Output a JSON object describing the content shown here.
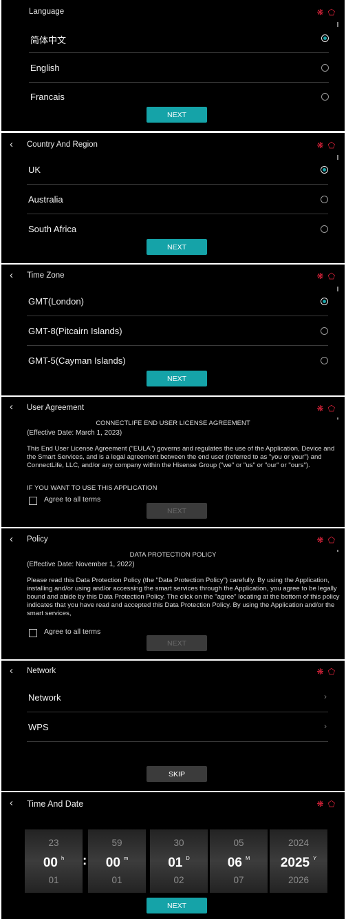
{
  "language": {
    "title": "Language",
    "options": [
      {
        "label": "简体中文",
        "selected": true
      },
      {
        "label": "English",
        "selected": false
      },
      {
        "label": "Francais",
        "selected": false
      }
    ],
    "next_label": "NEXT"
  },
  "country": {
    "title": "Country And Region",
    "options": [
      {
        "label": "UK",
        "selected": true
      },
      {
        "label": "Australia",
        "selected": false
      },
      {
        "label": "South Africa",
        "selected": false
      }
    ],
    "next_label": "NEXT"
  },
  "timezone": {
    "title": "Time Zone",
    "options": [
      {
        "label": "GMT(London)",
        "selected": true
      },
      {
        "label": "GMT-8(Pitcairn Islands)",
        "selected": false
      },
      {
        "label": "GMT-5(Cayman Islands)",
        "selected": false
      }
    ],
    "next_label": "NEXT"
  },
  "user_agreement": {
    "title": "User Agreement",
    "doc_title": "CONNECTLIFE END USER LICENSE AGREEMENT",
    "effective_date": "(Effective Date: March 1, 2023)",
    "body": "This End User License Agreement (\"EULA\") governs and regulates the use of the Application, Device and the Smart Services, and is a legal agreement between the end user (referred to as \"you or your\") and ConnectLife, LLC, and/or any company within the Hisense Group (\"we\" or \"us\" or \"our\" or \"ours\").",
    "body2": "IF YOU WANT TO USE THIS APPLICATION",
    "agree_label": "Agree to all terms",
    "next_label": "NEXT"
  },
  "policy": {
    "title": "Policy",
    "doc_title": "DATA PROTECTION POLICY",
    "effective_date": "(Effective Date: November 1, 2022)",
    "body": "Please read this Data Protection Policy (the \"Data Protection Policy\") carefully. By using the Application, installing and/or using and/or accessing the smart services through the Application, you agree to be legally bound and abide by this Data Protection Policy. The click on the \"agree\" locating at the bottom of this policy indicates that you have read and accepted this Data Protection Policy. By using the Application and/or the smart services,",
    "agree_label": "Agree to all terms",
    "next_label": "NEXT"
  },
  "network": {
    "title": "Network",
    "items": [
      {
        "label": "Network"
      },
      {
        "label": "WPS"
      }
    ],
    "skip_label": "SKIP"
  },
  "time_date": {
    "title": "Time And Date",
    "columns": [
      {
        "prev": "23",
        "current": "00",
        "unit": "h",
        "next": "01"
      },
      {
        "prev": "59",
        "current": "00",
        "unit": "m",
        "next": "01"
      },
      {
        "prev": "30",
        "current": "01",
        "unit": "D",
        "next": "02"
      },
      {
        "prev": "05",
        "current": "06",
        "unit": "M",
        "next": "07"
      },
      {
        "prev": "2024",
        "current": "2025",
        "unit": "Y",
        "next": "2026"
      }
    ],
    "colon": ":",
    "next_label": "NEXT"
  },
  "icons": {
    "back": "back-arrow-icon",
    "snow": "snowflake-icon",
    "tag": "tag-icon",
    "radio": "radio-icon",
    "chevron": "chevron-right-icon"
  },
  "colors": {
    "accent": "#15a3a8",
    "alert_red": "#e0243c",
    "panel_bg": "#000000"
  }
}
